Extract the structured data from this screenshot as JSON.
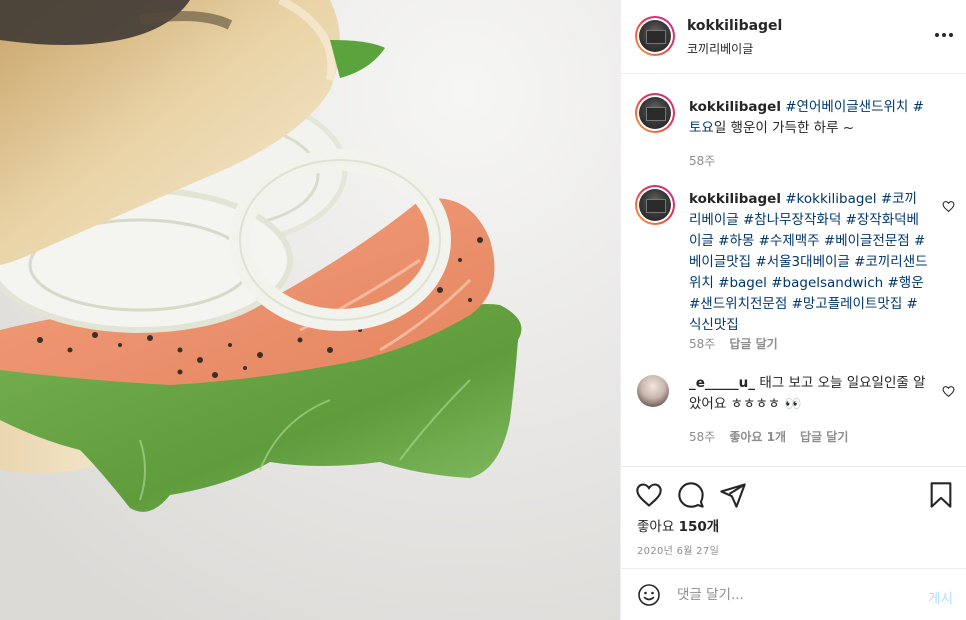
{
  "post": {
    "username": "kokkilibagel",
    "location": "코끼리베이글",
    "more_icon": "more-options-icon"
  },
  "caption": {
    "username": "kokkilibagel",
    "tags": [
      "#연어베이글샌드위치",
      "#토요"
    ],
    "text": "일 행운이 가득한 하루 ~",
    "time": "58주"
  },
  "comments": [
    {
      "username": "kokkilibagel",
      "tags": [
        "#kokkilibagel",
        "#코끼리베이글",
        "#참나무장작화덕",
        "#장작화덕베이글",
        "#하몽",
        "#수제맥주",
        "#베이글전문점",
        "#베이글맛집",
        "#서울3대베이글",
        "#코끼리샌드위치",
        "#bagel",
        "#bagelsandwich",
        "#행운",
        "#샌드위치전문점",
        "#망고플레이트맛집",
        "#식신맛집"
      ],
      "time": "58주",
      "reply": "답글 달기"
    },
    {
      "username": "_e_____u_",
      "text": "태그 보고 오늘 일요일인줄 알았어요 ㅎㅎㅎㅎ 👀",
      "time": "58주",
      "likes_label": "좋아요 1개",
      "reply": "답글 달기"
    }
  ],
  "actions": {
    "like_icon": "heart-icon",
    "comment_icon": "comment-icon",
    "share_icon": "share-icon",
    "save_icon": "bookmark-icon",
    "likes_prefix": "좋아요",
    "likes_count": "150개",
    "date": "2020년 6월 27일"
  },
  "comment_box": {
    "placeholder": "댓글 달기...",
    "post_label": "게시",
    "emoji_icon": "emoji-icon"
  },
  "colors": {
    "hashtag": "#00376b",
    "muted": "#8e8e8e",
    "post_button": "#b2dffc"
  }
}
